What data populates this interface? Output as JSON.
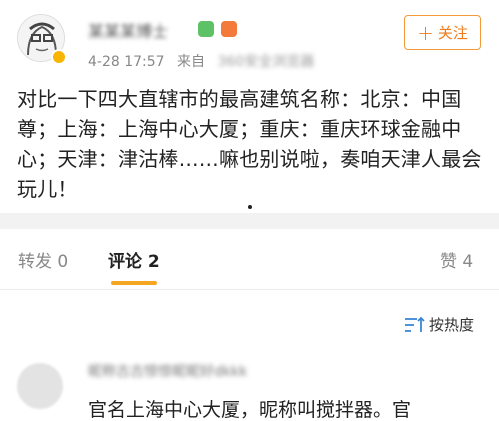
{
  "post": {
    "username": "某某某博士",
    "time": "4-28 17:57",
    "from_label": "来自",
    "source": "360安全浏览器",
    "follow_label": "关注",
    "follow_icon": "plus-icon",
    "content": "对比一下四大直辖市的最高建筑名称：北京：中国尊；上海：上海中心大厦；重庆：重庆环球金融中心；天津：津沽棒……嘛也别说啦，奏咱天津人最会玩儿！"
  },
  "tabs": {
    "repost": "转发 0",
    "comment": "评论 2",
    "like": "赞 4",
    "active": "comment",
    "accent_color": "#f5a623"
  },
  "sort": {
    "label": "按热度",
    "icon": "sort-icon"
  },
  "comment": {
    "username": "昵称古古惊惊昵昵好dkkk",
    "text": "官名上海中心大厦，昵称叫搅拌器。官"
  },
  "colors": {
    "follow_border": "#f29a3a",
    "follow_text": "#f07b1a",
    "verified_badge": "#f7b500"
  }
}
